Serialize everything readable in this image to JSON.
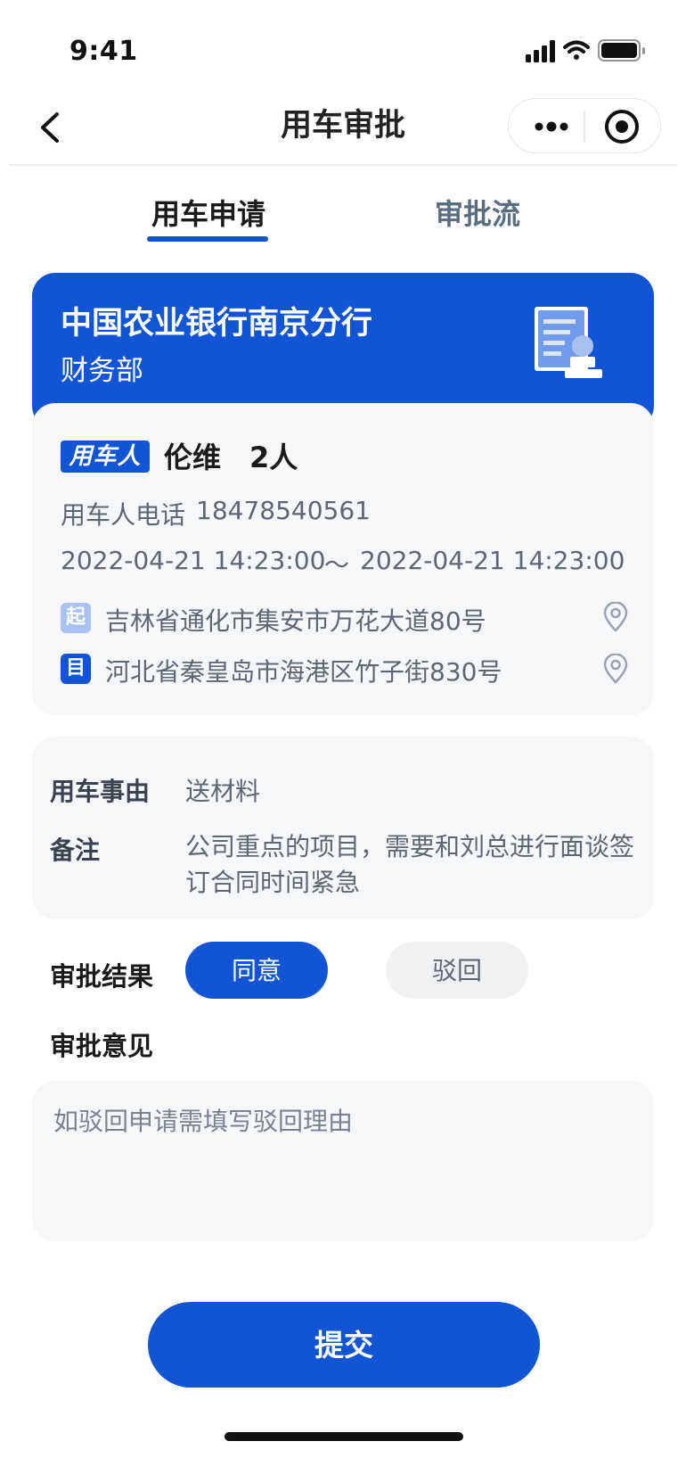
{
  "status_bar": {
    "time": "9:41"
  },
  "nav": {
    "title": "用车审批"
  },
  "tabs": [
    {
      "label": "用车申请",
      "active": true
    },
    {
      "label": "审批流",
      "active": false
    }
  ],
  "company_card": {
    "company": "中国农业银行南京分行",
    "department": "财务部"
  },
  "applicant": {
    "badge": "用车人",
    "name": "伦维",
    "count": "2人",
    "phone_label": "用车人电话",
    "phone": "18478540561",
    "time_start": "2022-04-21 14:23:00",
    "time_separator": "～",
    "time_end": "2022-04-21 14:23:00",
    "start_badge": "起",
    "start_address": "吉林省通化市集安市万花大道80号",
    "end_badge": "目",
    "end_address": "河北省秦皇岛市海港区竹子街830号"
  },
  "details": {
    "reason_label": "用车事由",
    "reason_value": "送材料",
    "remark_label": "备注",
    "remark_value": "公司重点的项目，需要和刘总进行面谈签订合同时间紧急"
  },
  "approval": {
    "result_label": "审批结果",
    "agree_label": "同意",
    "reject_label": "驳回",
    "selected": "同意",
    "opinion_label": "审批意见",
    "opinion_placeholder": "如驳回申请需填写驳回理由",
    "submit_label": "提交"
  },
  "colors": {
    "primary": "#1155d5",
    "card_bg": "#f6f7f9",
    "start_badge": "#a8c2ef"
  }
}
